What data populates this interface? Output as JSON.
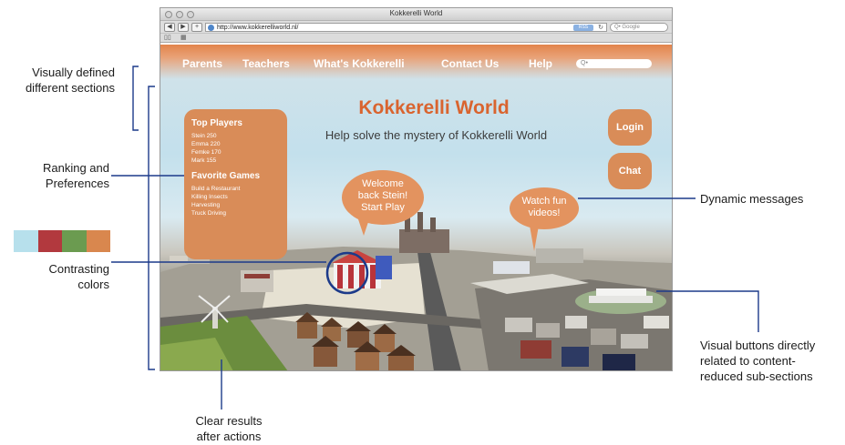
{
  "annotations": {
    "sections": [
      "Visually defined",
      "different sections"
    ],
    "ranking": [
      "Ranking and",
      "Preferences"
    ],
    "contrast": [
      "Contrasting",
      "colors"
    ],
    "clear_results": [
      "Clear results",
      "after actions"
    ],
    "dynamic_messages": "Dynamic messages",
    "visual_buttons": [
      "Visual buttons directly",
      "related to content-",
      "reduced sub-sections"
    ]
  },
  "swatch_colors": [
    "#b7e0ec",
    "#b2393e",
    "#6b9b50",
    "#d9874e"
  ],
  "browser": {
    "window_title": "Kokkerelli World",
    "url": "http://www.kokkerelliworld.nl/",
    "search_placeholder": "Q• Google",
    "rss_label": "RSS",
    "reload_icon": "reload-icon",
    "back_label": "◀",
    "forward_label": "▶",
    "add_label": "+"
  },
  "site": {
    "nav": [
      "Parents",
      "Teachers",
      "What's Kokkerelli",
      "Contact Us",
      "Help"
    ],
    "search_placeholder": "Q•",
    "title": "Kokkerelli World",
    "tagline": "Help solve the mystery of Kokkerelli World",
    "top_players_heading": "Top Players",
    "top_players": [
      "Stein 250",
      "Emma 220",
      "Femke 170",
      "Mark 155"
    ],
    "favorite_games_heading": "Favorite Games",
    "favorite_games": [
      "Build a Restaurant",
      "Killing Insects",
      "Harvesting",
      "Truck Driving"
    ],
    "login_label": "Login",
    "chat_label": "Chat",
    "welcome_bubble": [
      "Welcome",
      "back Stein!",
      "Start Play"
    ],
    "video_bubble": [
      "Watch fun",
      "videos!"
    ]
  },
  "colors": {
    "accent_orange": "#d98c58",
    "title_orange": "#d9642f",
    "annotation_line": "#1c3a8a"
  }
}
